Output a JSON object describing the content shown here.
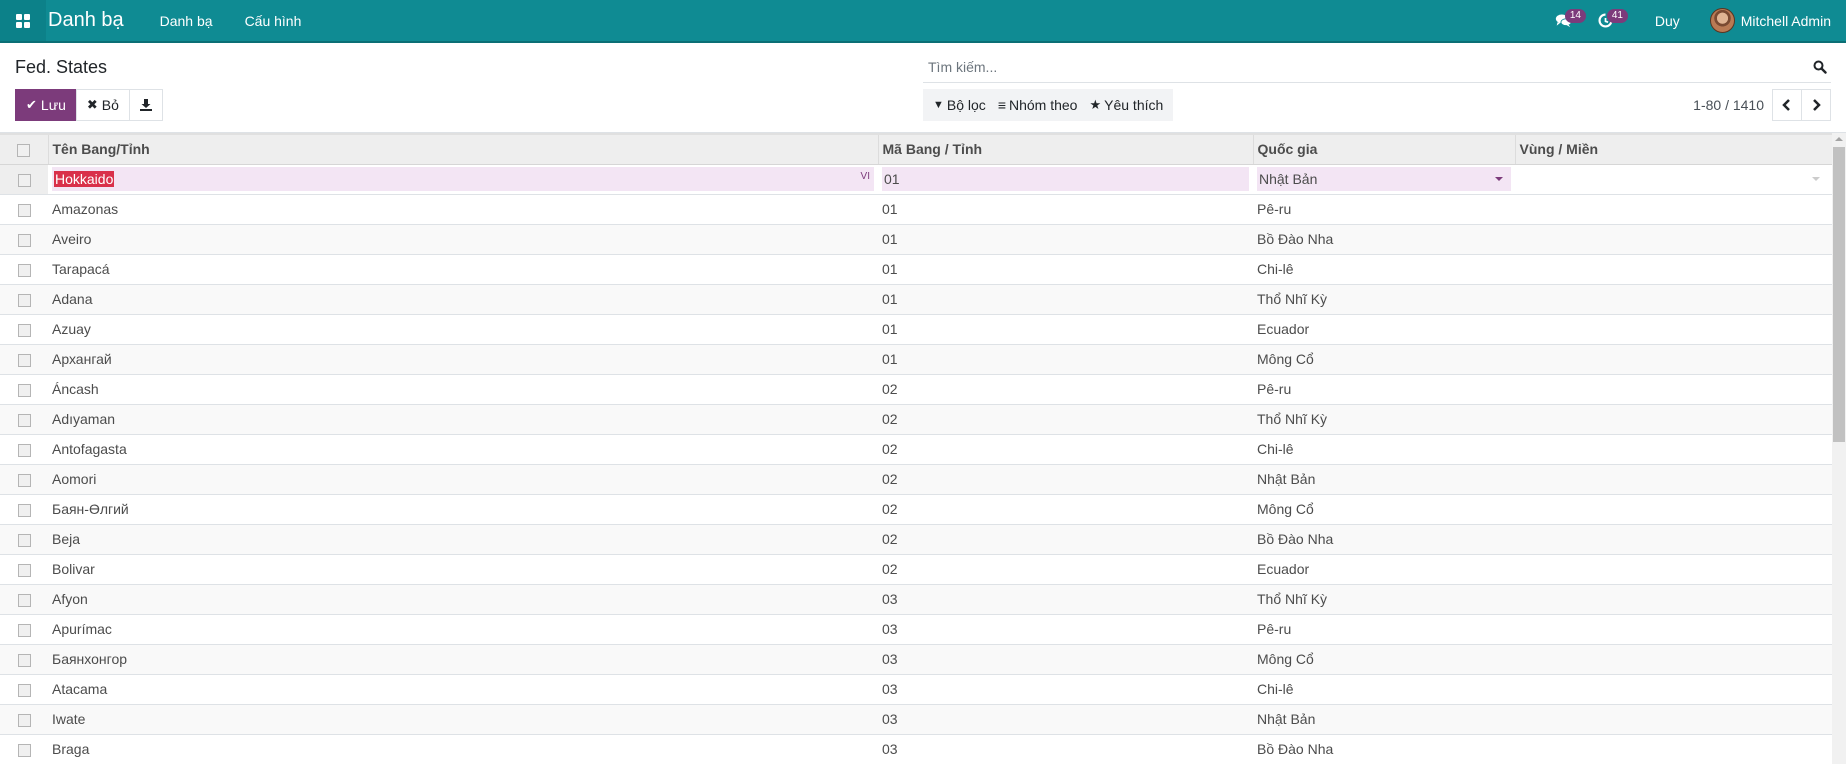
{
  "navbar": {
    "app_name": "Danh bạ",
    "menus": [
      "Danh bạ",
      "Cấu hình"
    ],
    "messages_count": "14",
    "activities_count": "41",
    "company": "Duy",
    "user_name": "Mitchell Admin"
  },
  "control_panel": {
    "breadcrumb": "Fed. States",
    "save_label": "Lưu",
    "discard_label": "Bỏ",
    "search_placeholder": "Tìm kiếm...",
    "filters_label": "Bộ lọc",
    "group_by_label": "Nhóm theo",
    "favorites_label": "Yêu thích",
    "pager": "1-80 / 1410"
  },
  "colors": {
    "navbar": "#0f8b93",
    "primary": "#7c3b7b",
    "edit_row": "#f3e5f4",
    "selection": "#d9304a"
  },
  "table": {
    "columns": [
      "Tên Bang/Tỉnh",
      "Mã Bang / Tỉnh",
      "Quốc gia",
      "Vùng / Miền"
    ],
    "editing_row": {
      "name": "Hokkaido",
      "lang_tag": "VI",
      "code": "01",
      "country": "Nhật Bản",
      "region": ""
    },
    "rows": [
      {
        "name": "Amazonas",
        "code": "01",
        "country": "Pê-ru",
        "region": ""
      },
      {
        "name": "Aveiro",
        "code": "01",
        "country": "Bồ Đào Nha",
        "region": ""
      },
      {
        "name": "Tarapacá",
        "code": "01",
        "country": "Chi-lê",
        "region": ""
      },
      {
        "name": "Adana",
        "code": "01",
        "country": "Thổ Nhĩ Kỳ",
        "region": ""
      },
      {
        "name": "Azuay",
        "code": "01",
        "country": "Ecuador",
        "region": ""
      },
      {
        "name": "Архангай",
        "code": "01",
        "country": "Mông Cổ",
        "region": ""
      },
      {
        "name": "Áncash",
        "code": "02",
        "country": "Pê-ru",
        "region": ""
      },
      {
        "name": "Adıyaman",
        "code": "02",
        "country": "Thổ Nhĩ Kỳ",
        "region": ""
      },
      {
        "name": "Antofagasta",
        "code": "02",
        "country": "Chi-lê",
        "region": ""
      },
      {
        "name": "Aomori",
        "code": "02",
        "country": "Nhật Bản",
        "region": ""
      },
      {
        "name": "Баян-Өлгий",
        "code": "02",
        "country": "Mông Cổ",
        "region": ""
      },
      {
        "name": "Beja",
        "code": "02",
        "country": "Bồ Đào Nha",
        "region": ""
      },
      {
        "name": "Bolivar",
        "code": "02",
        "country": "Ecuador",
        "region": ""
      },
      {
        "name": "Afyon",
        "code": "03",
        "country": "Thổ Nhĩ Kỳ",
        "region": ""
      },
      {
        "name": "Apurímac",
        "code": "03",
        "country": "Pê-ru",
        "region": ""
      },
      {
        "name": "Баянхонгор",
        "code": "03",
        "country": "Mông Cổ",
        "region": ""
      },
      {
        "name": "Atacama",
        "code": "03",
        "country": "Chi-lê",
        "region": ""
      },
      {
        "name": "Iwate",
        "code": "03",
        "country": "Nhật Bản",
        "region": ""
      },
      {
        "name": "Braga",
        "code": "03",
        "country": "Bồ Đào Nha",
        "region": ""
      }
    ]
  }
}
